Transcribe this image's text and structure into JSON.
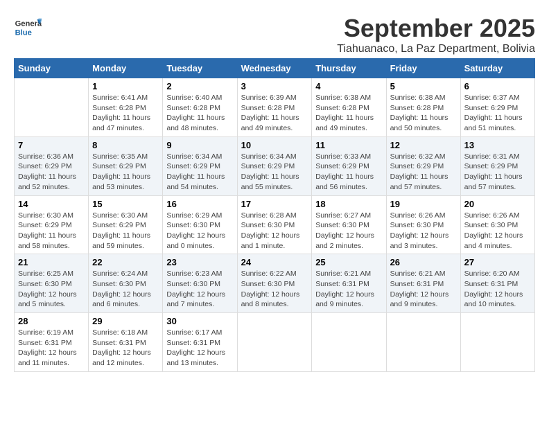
{
  "header": {
    "logo_general": "General",
    "logo_blue": "Blue",
    "title": "September 2025",
    "subtitle": "Tiahuanaco, La Paz Department, Bolivia"
  },
  "weekdays": [
    "Sunday",
    "Monday",
    "Tuesday",
    "Wednesday",
    "Thursday",
    "Friday",
    "Saturday"
  ],
  "weeks": [
    [
      {
        "day": "",
        "sunrise": "",
        "sunset": "",
        "daylight": ""
      },
      {
        "day": "1",
        "sunrise": "Sunrise: 6:41 AM",
        "sunset": "Sunset: 6:28 PM",
        "daylight": "Daylight: 11 hours and 47 minutes."
      },
      {
        "day": "2",
        "sunrise": "Sunrise: 6:40 AM",
        "sunset": "Sunset: 6:28 PM",
        "daylight": "Daylight: 11 hours and 48 minutes."
      },
      {
        "day": "3",
        "sunrise": "Sunrise: 6:39 AM",
        "sunset": "Sunset: 6:28 PM",
        "daylight": "Daylight: 11 hours and 49 minutes."
      },
      {
        "day": "4",
        "sunrise": "Sunrise: 6:38 AM",
        "sunset": "Sunset: 6:28 PM",
        "daylight": "Daylight: 11 hours and 49 minutes."
      },
      {
        "day": "5",
        "sunrise": "Sunrise: 6:38 AM",
        "sunset": "Sunset: 6:28 PM",
        "daylight": "Daylight: 11 hours and 50 minutes."
      },
      {
        "day": "6",
        "sunrise": "Sunrise: 6:37 AM",
        "sunset": "Sunset: 6:29 PM",
        "daylight": "Daylight: 11 hours and 51 minutes."
      }
    ],
    [
      {
        "day": "7",
        "sunrise": "Sunrise: 6:36 AM",
        "sunset": "Sunset: 6:29 PM",
        "daylight": "Daylight: 11 hours and 52 minutes."
      },
      {
        "day": "8",
        "sunrise": "Sunrise: 6:35 AM",
        "sunset": "Sunset: 6:29 PM",
        "daylight": "Daylight: 11 hours and 53 minutes."
      },
      {
        "day": "9",
        "sunrise": "Sunrise: 6:34 AM",
        "sunset": "Sunset: 6:29 PM",
        "daylight": "Daylight: 11 hours and 54 minutes."
      },
      {
        "day": "10",
        "sunrise": "Sunrise: 6:34 AM",
        "sunset": "Sunset: 6:29 PM",
        "daylight": "Daylight: 11 hours and 55 minutes."
      },
      {
        "day": "11",
        "sunrise": "Sunrise: 6:33 AM",
        "sunset": "Sunset: 6:29 PM",
        "daylight": "Daylight: 11 hours and 56 minutes."
      },
      {
        "day": "12",
        "sunrise": "Sunrise: 6:32 AM",
        "sunset": "Sunset: 6:29 PM",
        "daylight": "Daylight: 11 hours and 57 minutes."
      },
      {
        "day": "13",
        "sunrise": "Sunrise: 6:31 AM",
        "sunset": "Sunset: 6:29 PM",
        "daylight": "Daylight: 11 hours and 57 minutes."
      }
    ],
    [
      {
        "day": "14",
        "sunrise": "Sunrise: 6:30 AM",
        "sunset": "Sunset: 6:29 PM",
        "daylight": "Daylight: 11 hours and 58 minutes."
      },
      {
        "day": "15",
        "sunrise": "Sunrise: 6:30 AM",
        "sunset": "Sunset: 6:29 PM",
        "daylight": "Daylight: 11 hours and 59 minutes."
      },
      {
        "day": "16",
        "sunrise": "Sunrise: 6:29 AM",
        "sunset": "Sunset: 6:30 PM",
        "daylight": "Daylight: 12 hours and 0 minutes."
      },
      {
        "day": "17",
        "sunrise": "Sunrise: 6:28 AM",
        "sunset": "Sunset: 6:30 PM",
        "daylight": "Daylight: 12 hours and 1 minute."
      },
      {
        "day": "18",
        "sunrise": "Sunrise: 6:27 AM",
        "sunset": "Sunset: 6:30 PM",
        "daylight": "Daylight: 12 hours and 2 minutes."
      },
      {
        "day": "19",
        "sunrise": "Sunrise: 6:26 AM",
        "sunset": "Sunset: 6:30 PM",
        "daylight": "Daylight: 12 hours and 3 minutes."
      },
      {
        "day": "20",
        "sunrise": "Sunrise: 6:26 AM",
        "sunset": "Sunset: 6:30 PM",
        "daylight": "Daylight: 12 hours and 4 minutes."
      }
    ],
    [
      {
        "day": "21",
        "sunrise": "Sunrise: 6:25 AM",
        "sunset": "Sunset: 6:30 PM",
        "daylight": "Daylight: 12 hours and 5 minutes."
      },
      {
        "day": "22",
        "sunrise": "Sunrise: 6:24 AM",
        "sunset": "Sunset: 6:30 PM",
        "daylight": "Daylight: 12 hours and 6 minutes."
      },
      {
        "day": "23",
        "sunrise": "Sunrise: 6:23 AM",
        "sunset": "Sunset: 6:30 PM",
        "daylight": "Daylight: 12 hours and 7 minutes."
      },
      {
        "day": "24",
        "sunrise": "Sunrise: 6:22 AM",
        "sunset": "Sunset: 6:30 PM",
        "daylight": "Daylight: 12 hours and 8 minutes."
      },
      {
        "day": "25",
        "sunrise": "Sunrise: 6:21 AM",
        "sunset": "Sunset: 6:31 PM",
        "daylight": "Daylight: 12 hours and 9 minutes."
      },
      {
        "day": "26",
        "sunrise": "Sunrise: 6:21 AM",
        "sunset": "Sunset: 6:31 PM",
        "daylight": "Daylight: 12 hours and 9 minutes."
      },
      {
        "day": "27",
        "sunrise": "Sunrise: 6:20 AM",
        "sunset": "Sunset: 6:31 PM",
        "daylight": "Daylight: 12 hours and 10 minutes."
      }
    ],
    [
      {
        "day": "28",
        "sunrise": "Sunrise: 6:19 AM",
        "sunset": "Sunset: 6:31 PM",
        "daylight": "Daylight: 12 hours and 11 minutes."
      },
      {
        "day": "29",
        "sunrise": "Sunrise: 6:18 AM",
        "sunset": "Sunset: 6:31 PM",
        "daylight": "Daylight: 12 hours and 12 minutes."
      },
      {
        "day": "30",
        "sunrise": "Sunrise: 6:17 AM",
        "sunset": "Sunset: 6:31 PM",
        "daylight": "Daylight: 12 hours and 13 minutes."
      },
      {
        "day": "",
        "sunrise": "",
        "sunset": "",
        "daylight": ""
      },
      {
        "day": "",
        "sunrise": "",
        "sunset": "",
        "daylight": ""
      },
      {
        "day": "",
        "sunrise": "",
        "sunset": "",
        "daylight": ""
      },
      {
        "day": "",
        "sunrise": "",
        "sunset": "",
        "daylight": ""
      }
    ]
  ]
}
